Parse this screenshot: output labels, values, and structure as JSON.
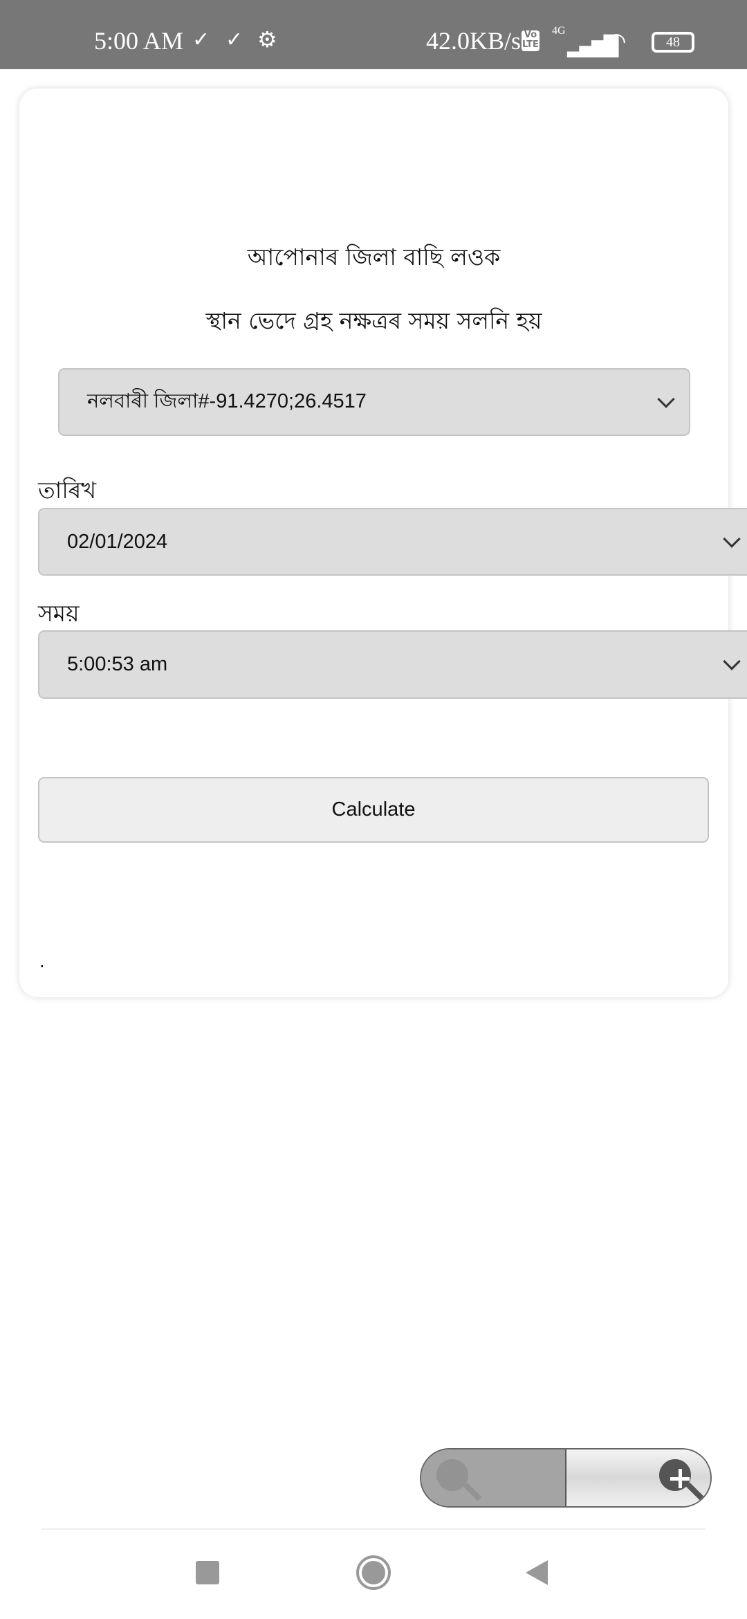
{
  "status_bar": {
    "time": "5:00 AM",
    "net_speed": "42.0KB/s",
    "volte": "Vo LTE",
    "network": "4G",
    "battery": "48"
  },
  "header": {
    "title": "আপোনাৰ জিলা বাছি লওক",
    "subtitle": "স্থান ভেদে গ্ৰহ নক্ষত্ৰৰ সময় সলনি হয়"
  },
  "form": {
    "district_value": "নলবাৰী জিলা#-91.4270;26.4517",
    "date_label": "তাৰিখ",
    "date_value": "02/01/2024",
    "time_label": "সময়",
    "time_value": "5:00:53 am",
    "calculate_label": "Calculate",
    "result_text": "."
  },
  "zoom_controls": {
    "zoom_out_icon": "zoom-out-icon",
    "zoom_in_icon": "zoom-in-icon"
  },
  "nav": {
    "recents": "square-icon",
    "home": "circle-icon",
    "back": "triangle-icon"
  }
}
